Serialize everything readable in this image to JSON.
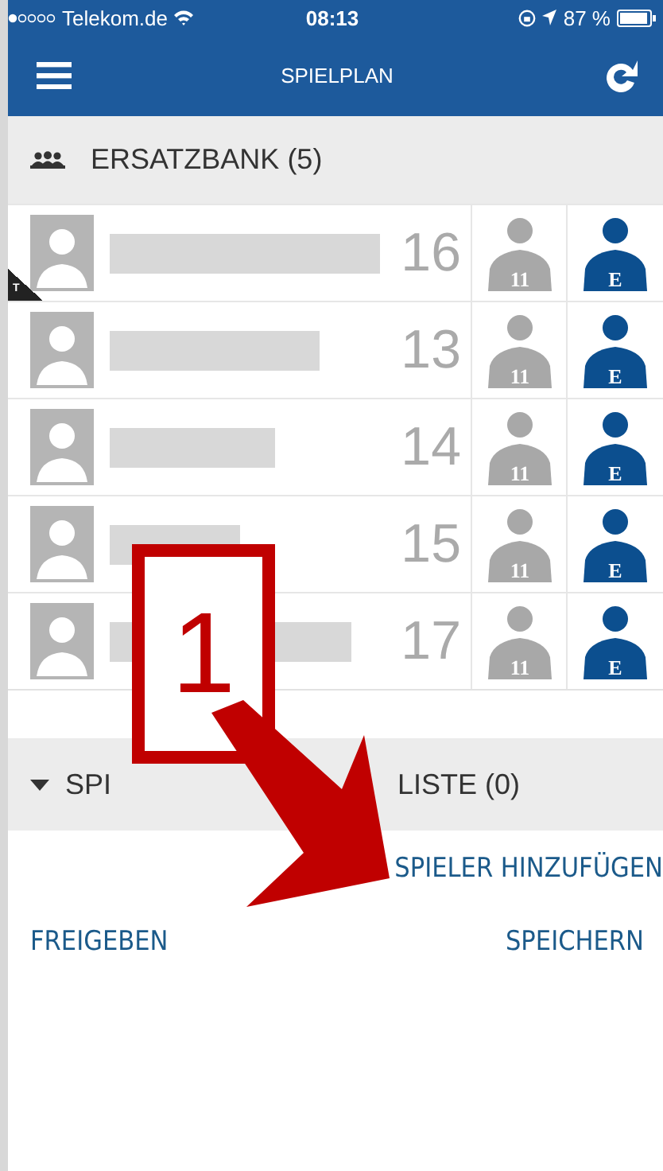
{
  "status_bar": {
    "carrier": "Telekom.de",
    "time": "08:13",
    "battery": "87 %"
  },
  "nav_bar": {
    "title": "SPIELPLAN"
  },
  "bench": {
    "title": "ERSATZBANK (5)",
    "rows": [
      {
        "number": "16",
        "badge": "T",
        "starting": false,
        "starting_label": "11",
        "substitute": true,
        "substitute_label": "E"
      },
      {
        "number": "13",
        "starting": false,
        "starting_label": "11",
        "substitute": true,
        "substitute_label": "E"
      },
      {
        "number": "14",
        "starting": false,
        "starting_label": "11",
        "substitute": true,
        "substitute_label": "E"
      },
      {
        "number": "15",
        "starting": false,
        "starting_label": "11",
        "substitute": true,
        "substitute_label": "E"
      },
      {
        "number": "17",
        "starting": false,
        "starting_label": "11",
        "substitute": true,
        "substitute_label": "E"
      }
    ]
  },
  "eligible_section": {
    "expanded": true,
    "title_start": "SPI",
    "title_end": "LISTE (0)",
    "add_link": "SPIELER HINZUFÜGEN"
  },
  "footer": {
    "left_button": "FREIGEBEN",
    "right_button": "SPEICHERN"
  },
  "annotation": {
    "label": "1"
  }
}
